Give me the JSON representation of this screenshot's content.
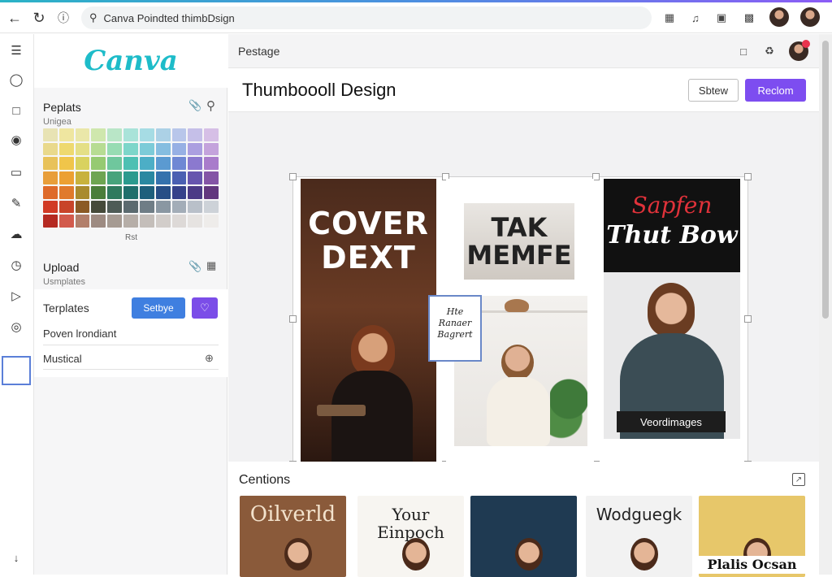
{
  "browser": {
    "url": "Canva Poindted thimbDsign",
    "icons": [
      "back-icon",
      "reload-icon",
      "info-icon",
      "search-icon",
      "extension-icon",
      "pin-icon",
      "cast-icon",
      "bookmark-icon"
    ]
  },
  "sidebar_panel": {
    "logo": "Canva",
    "palettes_title": "Peplats",
    "palettes_sub": "Unigea",
    "palette_footer": "Rst",
    "upload_title": "Upload",
    "upload_sub": "Usmplates",
    "templates_label": "Terplates",
    "settings_button": "Setbye",
    "row1": "Poven lrondiant",
    "row2": "Mustical"
  },
  "palette_colors": [
    [
      "#e8e3b4",
      "#efe6a0",
      "#eae7a9",
      "#cfe7ad",
      "#b9e6c7",
      "#a9e3d9",
      "#a6dce4",
      "#acd1e6",
      "#b8c6ea",
      "#c5bfe8",
      "#d6bfe6"
    ],
    [
      "#e9d98c",
      "#eed96f",
      "#e4df86",
      "#b7dc93",
      "#97dcb3",
      "#7dd6ca",
      "#7ccbd8",
      "#85bde0",
      "#97b0e4",
      "#ab9fe0",
      "#c4a3dc"
    ],
    [
      "#e8c25a",
      "#f0c54a",
      "#d9d25f",
      "#96ca72",
      "#6fc79d",
      "#4dc0b3",
      "#4caec6",
      "#5b9ad1",
      "#6f88d4",
      "#8b79cf",
      "#a97ccb"
    ],
    [
      "#e89e3a",
      "#eca033",
      "#c8b23d",
      "#6ea552",
      "#47a37c",
      "#2b9a8e",
      "#2a88a1",
      "#3572ad",
      "#4a5fb2",
      "#6655ae",
      "#8455a6"
    ],
    [
      "#de6a2a",
      "#e07a2c",
      "#a98b2e",
      "#4b7e3b",
      "#2f7a5e",
      "#1f6f6c",
      "#1e5f7c",
      "#274e86",
      "#36418a",
      "#4b3a86",
      "#62377e"
    ],
    [
      "#d13a25",
      "#c8442a",
      "#8b5a25",
      "#454a3a",
      "#4e5b56",
      "#5b6a6f",
      "#6f7d86",
      "#8a97a2",
      "#a3adb8",
      "#b9c0c9",
      "#cdd2d8"
    ],
    [
      "#b52a22",
      "#d25a4c",
      "#b27f6b",
      "#9d8b82",
      "#a69b93",
      "#b6aea8",
      "#c4beba",
      "#d2cdca",
      "#ddd9d7",
      "#e6e3e1",
      "#eeecea"
    ]
  ],
  "main": {
    "breadcrumb": "Pestage",
    "title": "Thumboooll Design",
    "secondary_button": "Sbtew",
    "primary_button": "Reclom",
    "card1_text": "COVER DEXT",
    "card2_text": "TAK MEMFE",
    "card3_line1": "Sapfen",
    "card3_line2": "Thut Bow",
    "card3_label": "Veordimages",
    "sticky_text": "Hte Ranaer Bagrert",
    "captions_title": "Centions",
    "thumbs": [
      {
        "text": "Oilverld",
        "bg": "#8a5a3a",
        "color": "#f3e2cc"
      },
      {
        "text": "Your Einpoch",
        "bg": "#f7f5f1",
        "color": "#222"
      },
      {
        "text": "",
        "bg": "#1f3a52",
        "color": "#fff"
      },
      {
        "text": "Wodguegk",
        "bg": "#f2f2f2",
        "color": "#222"
      },
      {
        "text": "Plalis Ocsan",
        "bg": "#e7c76a",
        "color": "#111"
      }
    ]
  }
}
